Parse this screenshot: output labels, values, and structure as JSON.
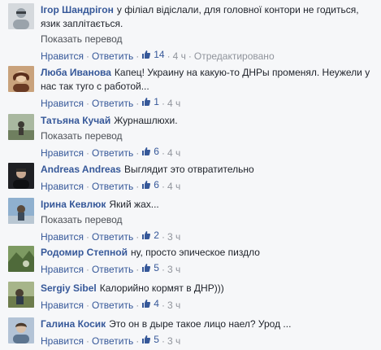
{
  "comments": [
    {
      "author": "Ігор Шандрігон",
      "text": "у філіал відіслали, для головної контори не годиться, язик заплітається.",
      "translate": "Показать перевод",
      "like": "Нравится",
      "reply": "Ответить",
      "likes": "14",
      "time": "4 ч",
      "edited": "Отредактировано",
      "avatar_color": "#b9c1c8"
    },
    {
      "author": "Люба Иванова",
      "text": "Капец! Украину на какую-то ДНРы променял. Неужели у нас так туго с работой...",
      "like": "Нравится",
      "reply": "Ответить",
      "likes": "1",
      "time": "4 ч",
      "avatar_color": "#8a5b3e"
    },
    {
      "author": "Татьяна Кучай",
      "text": "Журнашлюхи.",
      "translate": "Показать перевод",
      "like": "Нравится",
      "reply": "Ответить",
      "likes": "6",
      "time": "4 ч",
      "avatar_color": "#7a8a76"
    },
    {
      "author": "Andreas Andreas",
      "text": "Выглядит это отвратительно",
      "like": "Нравится",
      "reply": "Ответить",
      "likes": "6",
      "time": "4 ч",
      "avatar_color": "#2a2a2e"
    },
    {
      "author": "Ірина Кевлюк",
      "text": "Який жах...",
      "translate": "Показать перевод",
      "like": "Нравится",
      "reply": "Ответить",
      "likes": "2",
      "time": "3 ч",
      "avatar_color": "#6f8fb0"
    },
    {
      "author": "Родомир Степной",
      "text": "ну, просто эпическое пиздло",
      "like": "Нравится",
      "reply": "Ответить",
      "likes": "5",
      "time": "3 ч",
      "avatar_color": "#5c7a4a"
    },
    {
      "author": "Sergiy Sibel",
      "text": "Калорийно кормят в ДНР)))",
      "like": "Нравится",
      "reply": "Ответить",
      "likes": "4",
      "time": "3 ч",
      "avatar_color": "#7d8f5c"
    },
    {
      "author": "Галина Косик",
      "text": "Это он в дыре такое лицо наел? Урод ...",
      "like": "Нравится",
      "reply": "Ответить",
      "likes": "5",
      "time": "3 ч",
      "avatar_color": "#8f9fb5"
    }
  ],
  "accent": "#365899"
}
